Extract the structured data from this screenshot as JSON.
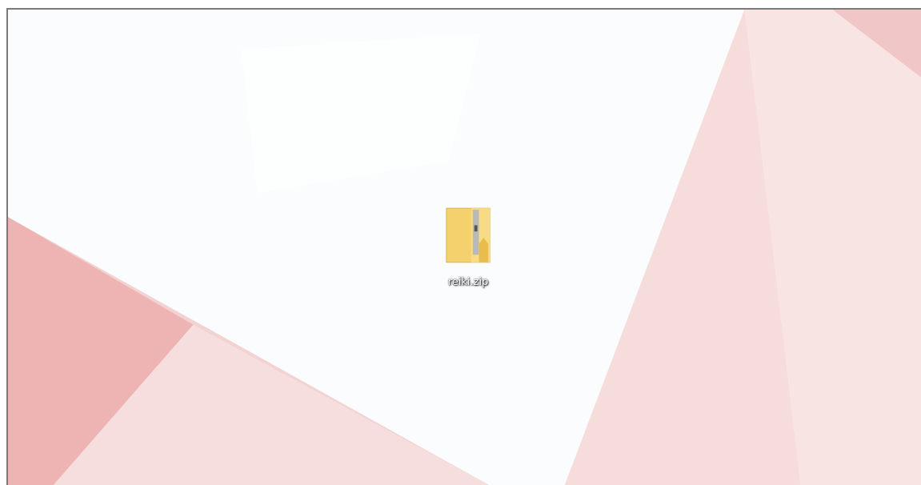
{
  "desktop": {
    "icons": [
      {
        "label": "reiki.zip"
      }
    ]
  }
}
